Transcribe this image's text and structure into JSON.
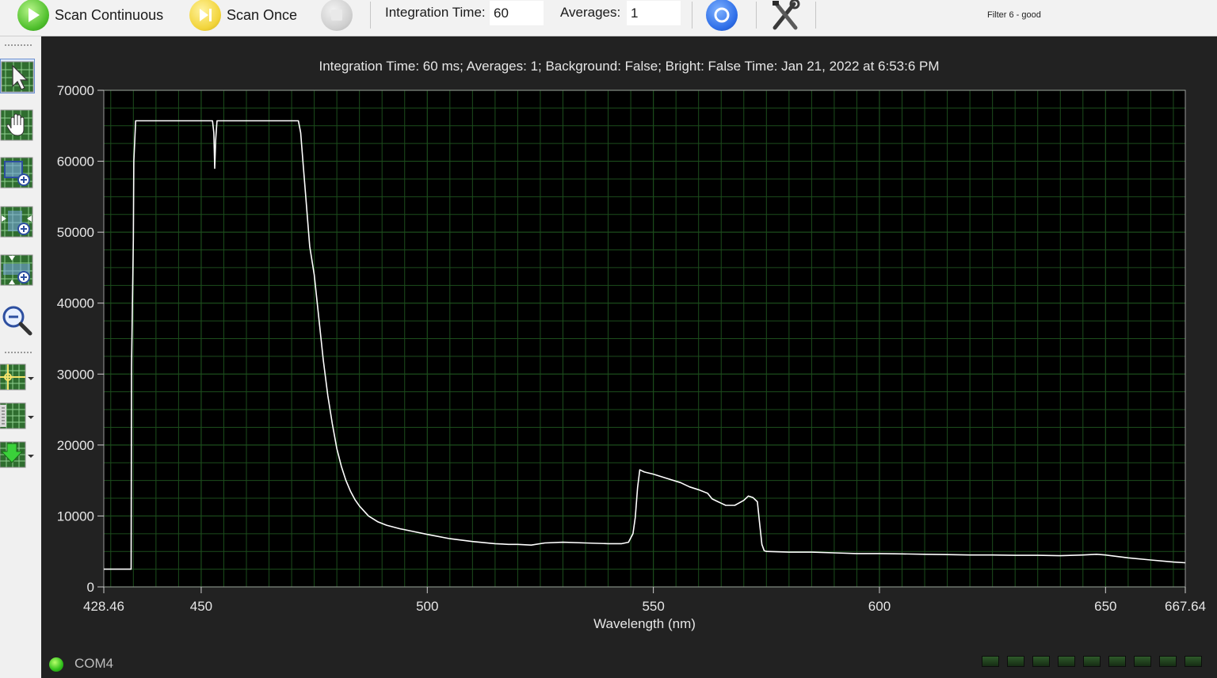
{
  "toolbar": {
    "scan_continuous_label": "Scan Continuous",
    "scan_once_label": "Scan Once",
    "integration_time_label": "Integration Time:",
    "integration_time_value": "60",
    "averages_label": "Averages:",
    "averages_value": "1",
    "status_text": "Filter 6 - good",
    "icons": [
      "play-icon",
      "scan-once-icon",
      "stop-icon",
      "record-icon",
      "tools-icon"
    ]
  },
  "sidebar": {
    "tools": [
      "pointer-tool-icon",
      "pan-hand-icon",
      "zoom-box-icon",
      "zoom-horizontal-icon",
      "zoom-vertical-icon",
      "zoom-out-icon",
      "crosshair-cursor-icon",
      "spectrum-ruler-icon",
      "download-icon"
    ]
  },
  "plot": {
    "title": "Integration Time: 60 ms; Averages: 1; Background: False; Bright: False Time: Jan 21, 2022 at 6:53:6 PM"
  },
  "status_bar": {
    "port_label": "COM4",
    "led_count": 9
  },
  "colors": {
    "background": "#222222",
    "plot_background": "#000000",
    "grid": "#1c4d1c",
    "trace": "#ffffff",
    "axis_text": "#e6e6e6"
  },
  "chart_data": {
    "type": "line",
    "title": "Integration Time: 60 ms; Averages: 1; Background: False; Bright: False Time: Jan 21, 2022 at 6:53:6 PM",
    "xlabel": "Wavelength (nm)",
    "ylabel": "",
    "xlim": [
      428.46,
      667.64
    ],
    "ylim": [
      0,
      70000
    ],
    "xticks": [
      428.46,
      450,
      500,
      550,
      600,
      650,
      667.64
    ],
    "yticks": [
      0,
      10000,
      20000,
      30000,
      40000,
      50000,
      60000,
      70000
    ],
    "grid": true,
    "series": [
      {
        "x": [
          428.46,
          434.5,
          434.6,
          435,
          435.1,
          435.5,
          440,
          445,
          450,
          452.5,
          452.8,
          453,
          453.2,
          453.5,
          454,
          460,
          465,
          471.5,
          472,
          472.5,
          473,
          474,
          475,
          476,
          477,
          478,
          479,
          480,
          481,
          482,
          483,
          484,
          485,
          487,
          489,
          491,
          494,
          497,
          500,
          505,
          510,
          515,
          518,
          520,
          523,
          526,
          530,
          535,
          540,
          543,
          544.5,
          545.5,
          546,
          546.5,
          547,
          548,
          550,
          553,
          556,
          558,
          560,
          562,
          563,
          564,
          565,
          566,
          568,
          570,
          571,
          572,
          573,
          573.5,
          574,
          574.5,
          575,
          580,
          585,
          590,
          595,
          600,
          605,
          610,
          615,
          620,
          625,
          630,
          635,
          640,
          645,
          648,
          650,
          655,
          660,
          665,
          667.64
        ],
        "values": [
          2500,
          2500,
          31000,
          49000,
          60000,
          65700,
          65700,
          65700,
          65700,
          65700,
          64000,
          59000,
          63000,
          65700,
          65700,
          65700,
          65700,
          65700,
          64000,
          60000,
          56000,
          48000,
          44000,
          38000,
          32000,
          27000,
          23000,
          19500,
          17000,
          15000,
          13500,
          12300,
          11400,
          10000,
          9200,
          8700,
          8200,
          7800,
          7400,
          6800,
          6400,
          6100,
          6000,
          6000,
          5900,
          6200,
          6300,
          6200,
          6100,
          6100,
          6300,
          7500,
          9800,
          14000,
          16500,
          16200,
          15900,
          15300,
          14700,
          14100,
          13700,
          13200,
          12400,
          12100,
          11800,
          11500,
          11500,
          12200,
          12800,
          12600,
          12000,
          9000,
          6000,
          5100,
          5000,
          4900,
          4900,
          4800,
          4700,
          4700,
          4650,
          4600,
          4550,
          4500,
          4500,
          4450,
          4450,
          4400,
          4500,
          4600,
          4500,
          4100,
          3800,
          3500,
          3400
        ]
      }
    ]
  }
}
